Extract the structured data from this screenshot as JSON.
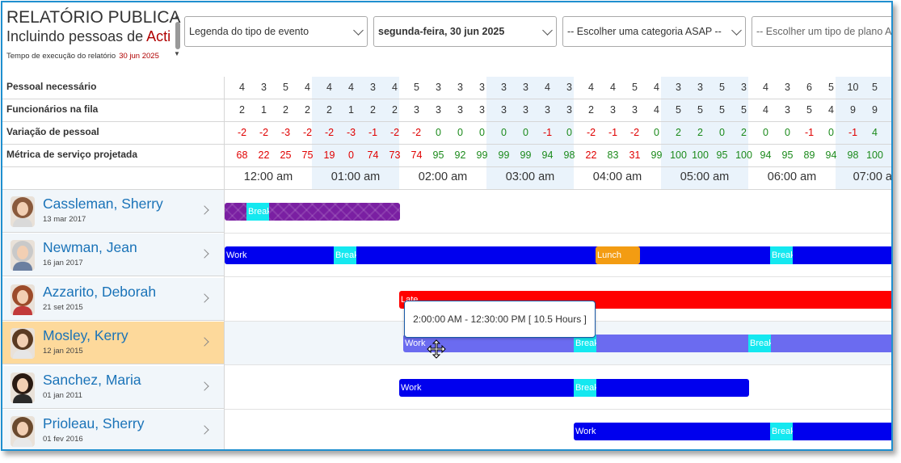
{
  "header": {
    "title": "RELATÓRIO PUBLICA",
    "subtitle": "Incluindo pessoas de ",
    "subtitle_red": "Acti",
    "exec_label": "Tempo de execução do relatório",
    "exec_date": "30 jun 2025"
  },
  "filters": {
    "legend": "Legenda do tipo de evento",
    "date": "segunda-feira, 30 jun 2025",
    "asap_category": "-- Escolher uma categoria ASAP --",
    "plan_type": "-- Escolher um tipo de plano ASAP --"
  },
  "metrics": {
    "labels": [
      "Pessoal necessário",
      "Funcionários na fila",
      "Variação de pessoal",
      "Métrica de serviço projetada"
    ],
    "required": [
      "4",
      "3",
      "5",
      "4",
      "4",
      "4",
      "3",
      "4",
      "5",
      "3",
      "3",
      "3",
      "3",
      "3",
      "4",
      "3",
      "4",
      "4",
      "5",
      "4",
      "3",
      "3",
      "5",
      "3",
      "4",
      "3",
      "6",
      "5",
      "10",
      "5"
    ],
    "queue": [
      "2",
      "1",
      "2",
      "2",
      "2",
      "1",
      "2",
      "2",
      "3",
      "3",
      "3",
      "3",
      "3",
      "3",
      "3",
      "3",
      "2",
      "3",
      "3",
      "4",
      "5",
      "5",
      "5",
      "5",
      "4",
      "3",
      "5",
      "4",
      "9",
      "9"
    ],
    "variance": [
      "-2",
      "-2",
      "-3",
      "-2",
      "-2",
      "-3",
      "-1",
      "-2",
      "-2",
      "0",
      "0",
      "0",
      "0",
      "0",
      "-1",
      "0",
      "-2",
      "-1",
      "-2",
      "0",
      "2",
      "2",
      "0",
      "2",
      "0",
      "0",
      "-1",
      "0",
      "-1",
      "4"
    ],
    "service": [
      "68",
      "22",
      "25",
      "75",
      "19",
      "0",
      "74",
      "73",
      "74",
      "95",
      "92",
      "99",
      "99",
      "99",
      "94",
      "98",
      "22",
      "83",
      "31",
      "99",
      "100",
      "100",
      "95",
      "100",
      "94",
      "95",
      "89",
      "94",
      "98",
      "100"
    ]
  },
  "hours": [
    "12:00 am",
    "01:00 am",
    "02:00 am",
    "03:00 am",
    "04:00 am",
    "05:00 am",
    "06:00 am",
    "07:00 a"
  ],
  "employees": [
    {
      "name": "Cassleman, Sherry",
      "date": "13 mar 2017"
    },
    {
      "name": "Newman, Jean",
      "date": "16 jan 2017"
    },
    {
      "name": "Azzarito, Deborah",
      "date": "21 set 2015"
    },
    {
      "name": "Mosley, Kerry",
      "date": "12 jan 2015"
    },
    {
      "name": "Sanchez, Maria",
      "date": "01 jan 2011"
    },
    {
      "name": "Prioleau, Sherry",
      "date": "01 fev 2016"
    }
  ],
  "events": {
    "break": "Break",
    "work": "Work",
    "lunch": "Lunch",
    "late": "Late"
  },
  "tooltip": "2:00:00 AM - 12:30:00 PM [ 10.5 Hours ]",
  "colors": {
    "work": "#0000ee",
    "work_light": "#6b6bf0",
    "break": "#14e8f0",
    "lunch": "#f39c12",
    "late": "#ff0000",
    "purple": "#7a1fa2",
    "name_blue": "#1a73b8",
    "selected_row": "#fdd99b"
  }
}
